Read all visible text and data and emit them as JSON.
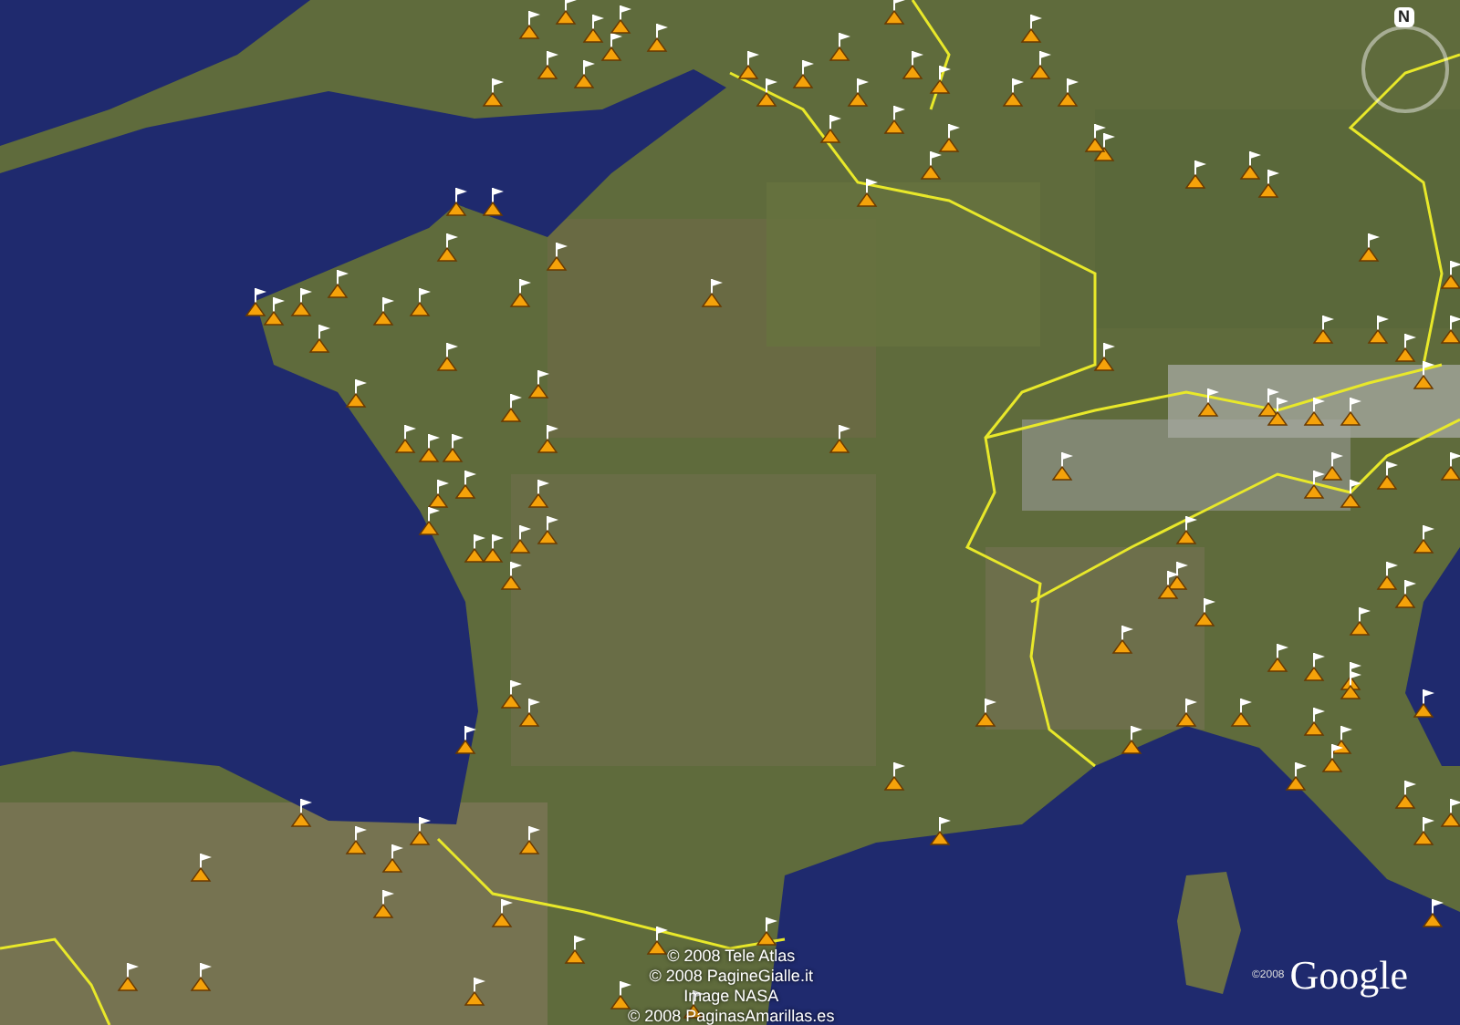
{
  "compass": {
    "label": "N"
  },
  "attribution": [
    "© 2008 Tele Atlas",
    "© 2008 PagineGialle.it",
    "Image NASA",
    "© 2008 PaginasAmarillas.es"
  ],
  "logo": {
    "copyright": "©2008",
    "text": "Google"
  }
}
